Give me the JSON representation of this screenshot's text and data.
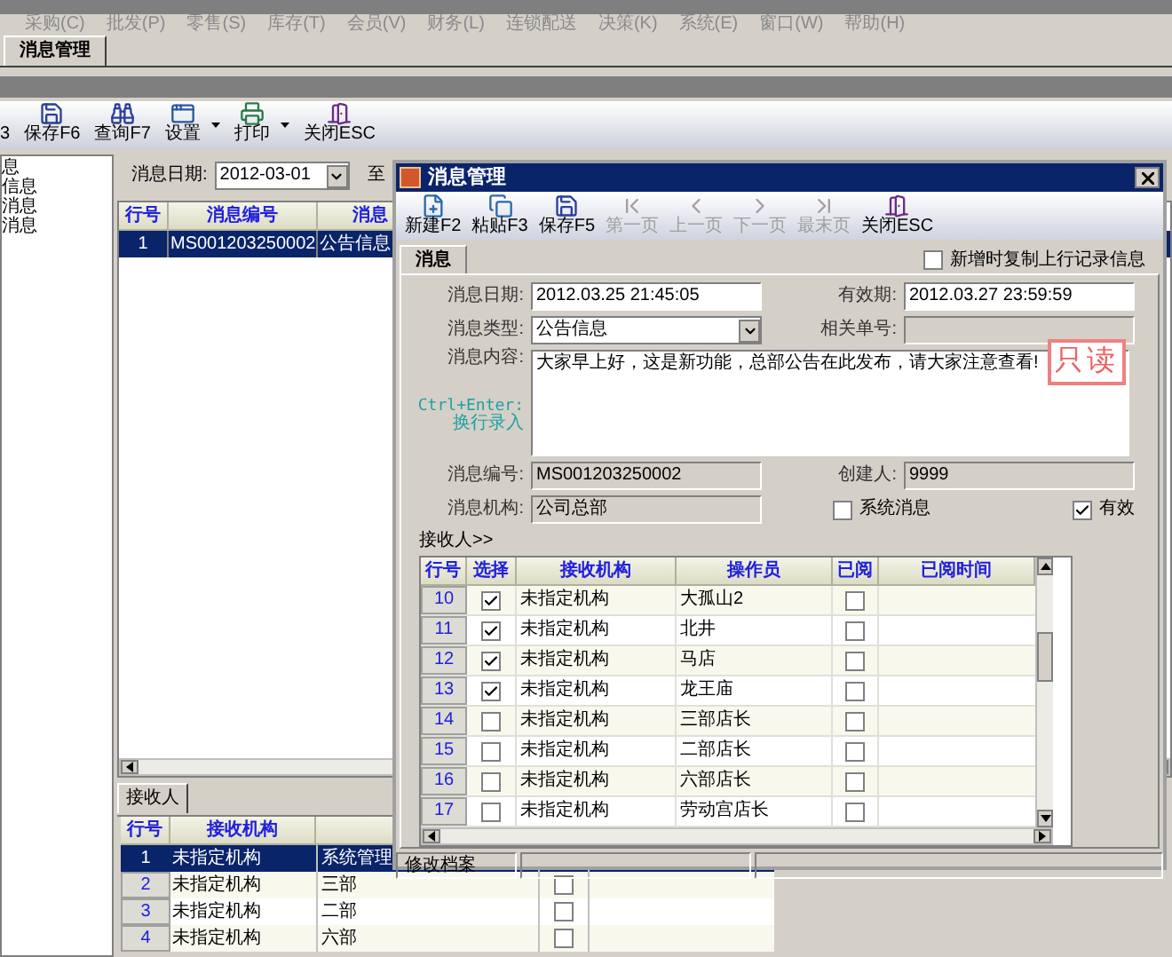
{
  "menu": [
    "采购(C)",
    "批发(P)",
    "零售(S)",
    "库存(T)",
    "会员(V)",
    "财务(L)",
    "连锁配送",
    "决策(K)",
    "系统(E)",
    "窗口(W)",
    "帮助(H)"
  ],
  "doc_tabs": [
    {
      "label": "消息管理",
      "selected": true
    }
  ],
  "toolbar": [
    {
      "label": "3",
      "kind": "none",
      "dropdown": false
    },
    {
      "label": "保存F6",
      "kind": "save",
      "dropdown": false
    },
    {
      "label": "查询F7",
      "kind": "binoculars",
      "dropdown": false
    },
    {
      "label": "设置",
      "kind": "window",
      "dropdown": true
    },
    {
      "label": "打印",
      "kind": "printer",
      "dropdown": true
    },
    {
      "label": "关闭ESC",
      "kind": "door",
      "dropdown": false
    }
  ],
  "tree": [
    "息",
    "信息",
    "消息",
    "消息"
  ],
  "filter": {
    "label": "消息日期:",
    "value": "2012-03-01",
    "to": "至"
  },
  "message_table": {
    "columns": [
      "行号",
      "消息编号",
      "消息"
    ],
    "rows": [
      {
        "cells": [
          "1",
          "MS001203250002",
          "公告信息"
        ],
        "selected": true
      }
    ]
  },
  "bottom_tabs": [
    {
      "label": "接收人",
      "selected": true
    }
  ],
  "receiver_table": {
    "columns": [
      "行号",
      "接收机构"
    ],
    "rows": [
      {
        "cells": [
          "1",
          "未指定机构",
          "系统管理"
        ],
        "selected": true
      },
      {
        "cells": [
          "2",
          "未指定机构",
          "三部"
        ],
        "selected": false,
        "checked": false
      },
      {
        "cells": [
          "3",
          "未指定机构",
          "二部"
        ],
        "selected": false,
        "checked": false
      },
      {
        "cells": [
          "4",
          "未指定机构",
          "六部"
        ],
        "selected": false,
        "checked": false
      }
    ]
  },
  "dialog": {
    "title": "消息管理",
    "toolbar": [
      {
        "label": "新建F2",
        "kind": "new",
        "disabled": false
      },
      {
        "label": "粘贴F3",
        "kind": "paste",
        "disabled": false
      },
      {
        "label": "保存F5",
        "kind": "save",
        "disabled": false
      },
      {
        "label": "第一页",
        "kind": "first",
        "disabled": true
      },
      {
        "label": "上一页",
        "kind": "prev",
        "disabled": true
      },
      {
        "label": "下一页",
        "kind": "next",
        "disabled": true
      },
      {
        "label": "最末页",
        "kind": "last",
        "disabled": true
      },
      {
        "label": "关闭ESC",
        "kind": "door",
        "disabled": false
      }
    ],
    "tabs": [
      {
        "label": "消息",
        "selected": true
      }
    ],
    "copy_option": {
      "label": "新增时复制上行记录信息",
      "checked": false
    },
    "date": {
      "label": "消息日期:",
      "value": "2012.03.25 21:45:05"
    },
    "expiry": {
      "label": "有效期:",
      "value": "2012.03.27 23:59:59"
    },
    "type": {
      "label": "消息类型:",
      "value": "公告信息"
    },
    "related_no": {
      "label": "相关单号:"
    },
    "content": {
      "label": "消息内容:",
      "hint": "Ctrl+Enter:",
      "hint_2": "换行录入",
      "value": "大家早上好，这是新功能，总部公告在此发布，请大家注意查看!"
    },
    "stamp": "只读",
    "number": {
      "label": "消息编号:",
      "value": "MS001203250002"
    },
    "creator": {
      "label": "创建人:",
      "value": "9999"
    },
    "org": {
      "label": "消息机构:",
      "value": "公司总部"
    },
    "system_message": {
      "label": "系统消息",
      "checked": false
    },
    "valid": {
      "label": "有效",
      "checked": true
    },
    "receivers_label": "接收人>>",
    "receivers": {
      "columns": [
        "行号",
        "选择",
        "接收机构",
        "操作员",
        "已阅",
        "已阅时间"
      ],
      "rows": [
        {
          "no": "10",
          "checked": true,
          "org": "未指定机构",
          "operator": "大孤山2",
          "read": false
        },
        {
          "no": "11",
          "checked": true,
          "org": "未指定机构",
          "operator": "北井",
          "read": false
        },
        {
          "no": "12",
          "checked": true,
          "org": "未指定机构",
          "operator": "马店",
          "read": false
        },
        {
          "no": "13",
          "checked": true,
          "org": "未指定机构",
          "operator": "龙王庙",
          "read": false
        },
        {
          "no": "14",
          "checked": false,
          "org": "未指定机构",
          "operator": "三部店长",
          "read": false
        },
        {
          "no": "15",
          "checked": false,
          "org": "未指定机构",
          "operator": "二部店长",
          "read": false
        },
        {
          "no": "16",
          "checked": false,
          "org": "未指定机构",
          "operator": "六部店长",
          "read": false
        },
        {
          "no": "17",
          "checked": false,
          "org": "未指定机构",
          "operator": "劳动宫店长",
          "read": false
        }
      ]
    },
    "status_bar": [
      "修改档案"
    ]
  }
}
